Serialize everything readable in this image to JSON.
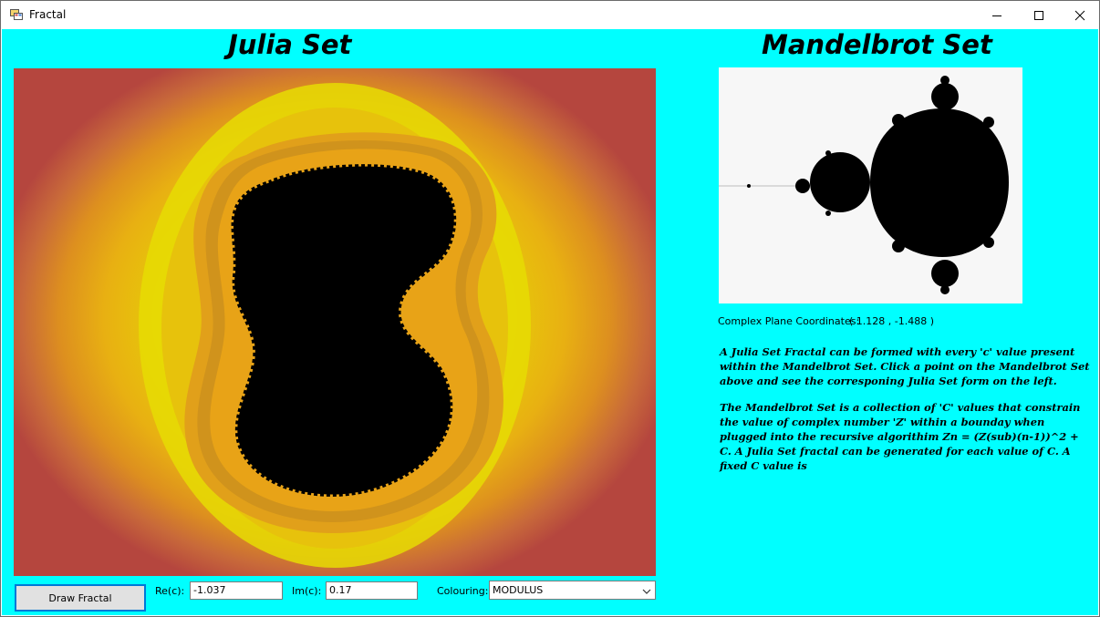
{
  "window": {
    "title": "Fractal",
    "icons": {
      "app": "app-icon",
      "minimize": "minimize-icon",
      "maximize": "maximize-icon",
      "close": "close-icon"
    }
  },
  "julia": {
    "heading": "Julia Set",
    "colors": {
      "background": "#e6e003",
      "band_orange": "#e8b012",
      "band_red": "#b5463e",
      "set": "#000000",
      "edge": "#e8a317"
    }
  },
  "mandelbrot": {
    "heading": "Mandelbrot Set",
    "coords_label": "Complex Plane Coordinates:",
    "coords_value": "( 1.128 , -1.488 )",
    "colors": {
      "background": "#f7f7f7",
      "set": "#000000"
    }
  },
  "description": {
    "p1": "A Julia Set Fractal can be formed with every 'c' value present within the Mandelbrot Set. Click a point on the Mandelbrot Set above and see the corresponing Julia Set form on the left.",
    "p2": "The Mandelbrot Set is a collection of 'C' values that constrain the value of complex number 'Z' within a bounday when plugged into the recursive algorithim Zn = (Z(sub)(n-1))^2 + C. A Julia Set fractal can be generated for each value of C. A fixed C value is"
  },
  "controls": {
    "draw_button": "Draw Fractal",
    "re_label": "Re(c):",
    "re_value": "-1.037",
    "im_label": "Im(c):",
    "im_value": "0.17",
    "colouring_label": "Colouring:",
    "colouring_value": "MODULUS",
    "combo_icon": "chevron-down-icon"
  },
  "colors": {
    "client_background": "#00ffff",
    "accent": "#0078d7"
  }
}
